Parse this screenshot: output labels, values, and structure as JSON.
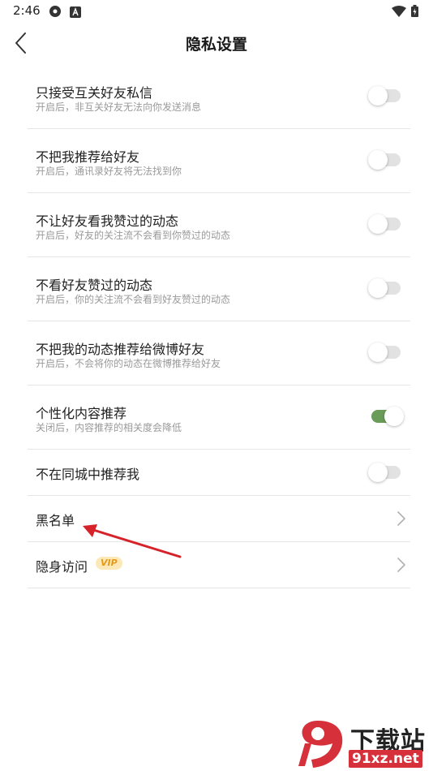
{
  "status_bar": {
    "time": "2:46",
    "icons": [
      "gear-icon",
      "a-icon",
      "wifi-icon",
      "battery-icon"
    ]
  },
  "header": {
    "title": "隐私设置",
    "back_icon": "chevron-left-icon"
  },
  "settings": [
    {
      "title": "只接受互关好友私信",
      "subtitle": "开启后，非互关好友无法向你发送消息",
      "enabled": false
    },
    {
      "title": "不把我推荐给好友",
      "subtitle": "开启后，通讯录好友将无法找到你",
      "enabled": false
    },
    {
      "title": "不让好友看我赞过的动态",
      "subtitle": "开启后，好友的关注流不会看到你赞过的动态",
      "enabled": false
    },
    {
      "title": "不看好友赞过的动态",
      "subtitle": "开启后，你的关注流不会看到好友赞过的动态",
      "enabled": false
    },
    {
      "title": "不把我的动态推荐给微博好友",
      "subtitle": "开启后，不会将你的动态在微博推荐给好友",
      "enabled": false
    },
    {
      "title": "个性化内容推荐",
      "subtitle": "关闭后，内容推荐的相关度会降低",
      "enabled": true
    },
    {
      "title": "不在同城中推荐我",
      "enabled": false
    }
  ],
  "links": [
    {
      "title": "黑名单"
    },
    {
      "title": "隐身访问",
      "badge": "VIP"
    }
  ],
  "colors": {
    "toggle_on": "#6a9b58",
    "toggle_off": "#e2e2e2",
    "annotation_arrow": "#d6232a",
    "vip_badge": "#fde9b8"
  },
  "watermark": {
    "title": "下载站",
    "url": "91xz.net"
  }
}
